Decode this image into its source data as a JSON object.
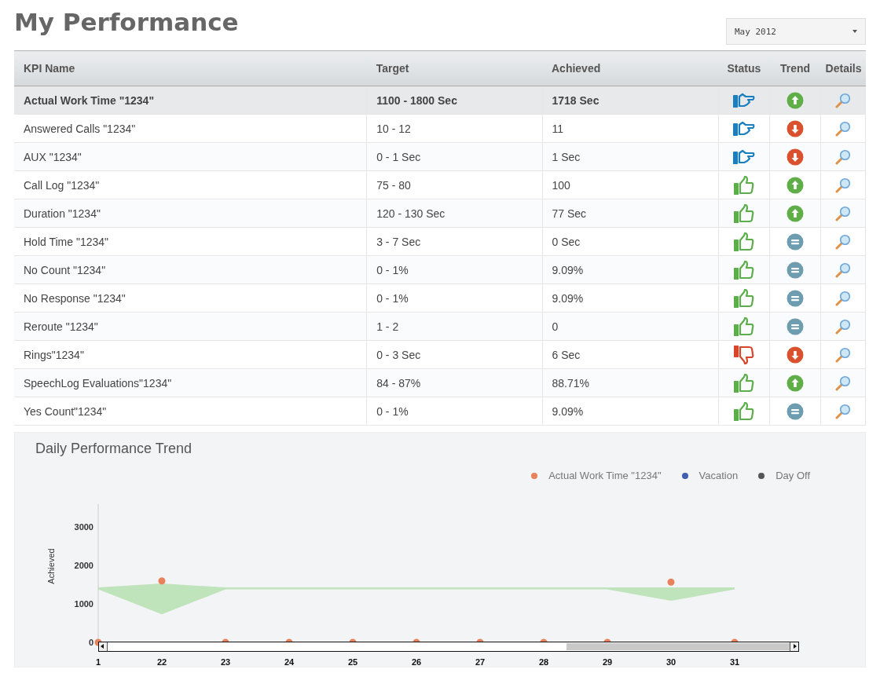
{
  "title": "My Performance",
  "period_select": {
    "value": "May  2012"
  },
  "table": {
    "columns": [
      "KPI Name",
      "Target",
      "Achieved",
      "Status",
      "Trend",
      "Details"
    ],
    "rows": [
      {
        "kpi": "Actual Work Time \"1234\"",
        "target": "1100 - 1800 Sec",
        "achieved": "1718 Sec",
        "status": {
          "kind": "neutral"
        },
        "trend": {
          "kind": "up"
        },
        "selected": true
      },
      {
        "kpi": "Answered Calls \"1234\"",
        "target": "10 - 12",
        "achieved": "11",
        "status": {
          "kind": "neutral"
        },
        "trend": {
          "kind": "down"
        },
        "selected": false
      },
      {
        "kpi": "AUX \"1234\"",
        "target": "0 - 1 Sec",
        "achieved": "1 Sec",
        "status": {
          "kind": "neutral"
        },
        "trend": {
          "kind": "down"
        },
        "selected": false
      },
      {
        "kpi": "Call Log \"1234\"",
        "target": "75 - 80",
        "achieved": "100",
        "status": {
          "kind": "good"
        },
        "trend": {
          "kind": "up"
        },
        "selected": false
      },
      {
        "kpi": "Duration \"1234\"",
        "target": "120 - 130 Sec",
        "achieved": "77 Sec",
        "status": {
          "kind": "good"
        },
        "trend": {
          "kind": "up"
        },
        "selected": false
      },
      {
        "kpi": "Hold Time \"1234\"",
        "target": "3 - 7 Sec",
        "achieved": "0 Sec",
        "status": {
          "kind": "good"
        },
        "trend": {
          "kind": "equal"
        },
        "selected": false
      },
      {
        "kpi": "No Count \"1234\"",
        "target": "0 - 1%",
        "achieved": "9.09%",
        "status": {
          "kind": "good"
        },
        "trend": {
          "kind": "equal"
        },
        "selected": false
      },
      {
        "kpi": "No Response \"1234\"",
        "target": "0 - 1%",
        "achieved": "9.09%",
        "status": {
          "kind": "good"
        },
        "trend": {
          "kind": "equal"
        },
        "selected": false
      },
      {
        "kpi": "Reroute \"1234\"",
        "target": "1 - 2",
        "achieved": "0",
        "status": {
          "kind": "good"
        },
        "trend": {
          "kind": "equal"
        },
        "selected": false
      },
      {
        "kpi": "Rings\"1234\"",
        "target": "0 - 3 Sec",
        "achieved": "6 Sec",
        "status": {
          "kind": "bad"
        },
        "trend": {
          "kind": "down"
        },
        "selected": false
      },
      {
        "kpi": "SpeechLog Evaluations\"1234\"",
        "target": "84 - 87%",
        "achieved": "88.71%",
        "status": {
          "kind": "good"
        },
        "trend": {
          "kind": "up"
        },
        "selected": false
      },
      {
        "kpi": "Yes Count\"1234\"",
        "target": "0 - 1%",
        "achieved": "9.09%",
        "status": {
          "kind": "good"
        },
        "trend": {
          "kind": "equal"
        },
        "selected": false
      }
    ]
  },
  "trend_panel": {
    "title": "Daily Performance Trend",
    "chart_data": {
      "type": "scatter",
      "ylabel": "Achieved",
      "categories": [
        "1",
        "22",
        "23",
        "24",
        "25",
        "26",
        "27",
        "28",
        "29",
        "30",
        "31"
      ],
      "ylim": [
        0,
        3600
      ],
      "yticks": [
        0,
        1000,
        2000,
        3000
      ],
      "series": [
        {
          "name": "Actual Work Time \"1234\"",
          "color": "#e8825c",
          "values": [
            0,
            1600,
            0,
            0,
            0,
            0,
            0,
            0,
            0,
            1570,
            0
          ]
        },
        {
          "name": "Vacation",
          "color": "#3f5fb0",
          "values": [
            null,
            null,
            null,
            null,
            null,
            null,
            null,
            null,
            null,
            null,
            null
          ]
        },
        {
          "name": "Day Off",
          "color": "#555555",
          "values": [
            null,
            null,
            null,
            null,
            null,
            null,
            null,
            null,
            null,
            null,
            null
          ]
        }
      ]
    }
  }
}
